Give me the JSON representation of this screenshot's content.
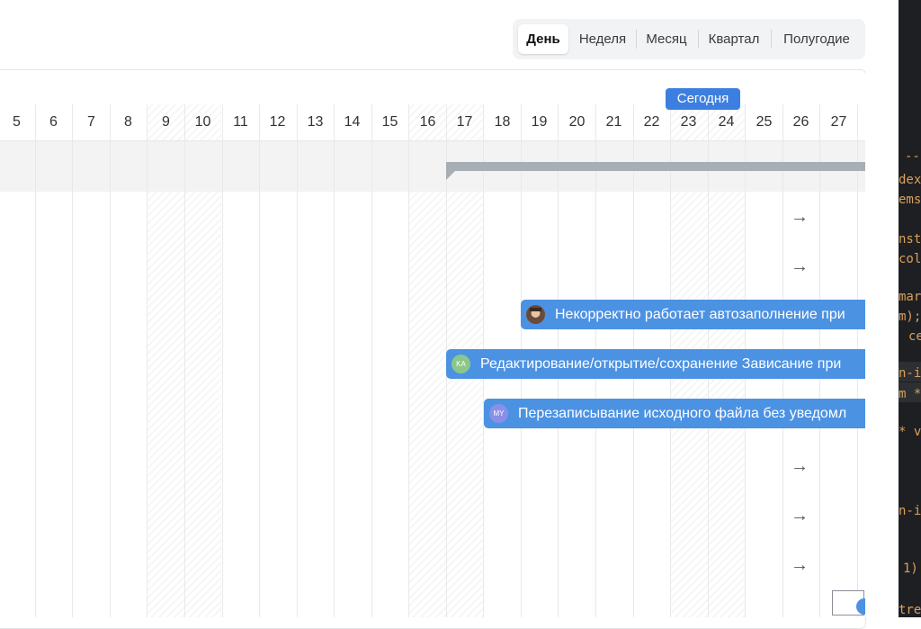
{
  "view_switcher": {
    "options": [
      "День",
      "Неделя",
      "Месяц",
      "Квартал",
      "Полугодие"
    ],
    "active": "День"
  },
  "timeline": {
    "days": [
      "5",
      "6",
      "7",
      "8",
      "9",
      "10",
      "11",
      "12",
      "13",
      "14",
      "15",
      "16",
      "17",
      "18",
      "19",
      "20",
      "21",
      "22",
      "23",
      "24",
      "25",
      "26",
      "27"
    ],
    "today_label": "Сегодня"
  },
  "tasks": [
    {
      "label": "Некорректно работает автозаполнение при",
      "avatar": "",
      "avatar_color": "#b98a6a"
    },
    {
      "label": "Редактирование/открытие/сохранение Зависание при",
      "avatar": "KA",
      "avatar_color": "#8bc78a"
    },
    {
      "label": "Перезаписывание исходного файла без уведомл",
      "avatar": "MY",
      "avatar_color": "#8a8fe8"
    }
  ],
  "row_arrow": "→",
  "colors": {
    "accent": "#4c92e3",
    "today": "#3d7fe0",
    "group_bar": "#a7aeb4"
  },
  "code_snippets": [
    "--",
    "dex",
    "ems",
    "nst",
    "col",
    "mar",
    "m);",
    "ce",
    "n-i",
    "m *",
    "* v",
    "n-i",
    "1)",
    "tre"
  ]
}
